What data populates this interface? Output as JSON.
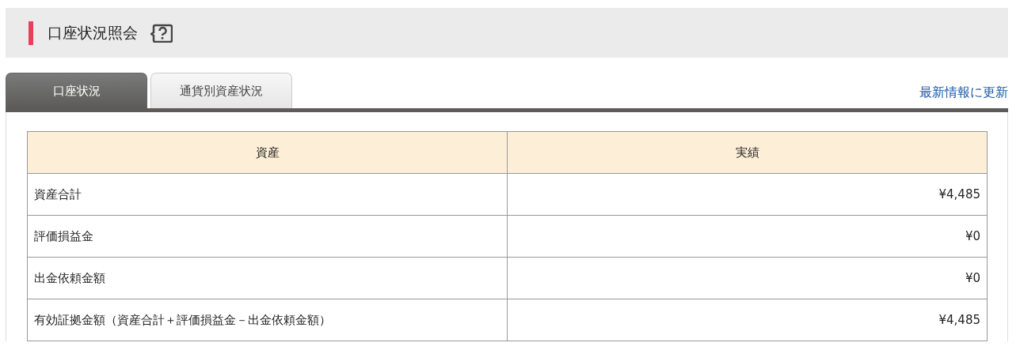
{
  "page_title": "口座状況照会",
  "tabs": [
    {
      "label": "口座状況",
      "selected": true
    },
    {
      "label": "通貨別資産状況",
      "selected": false
    }
  ],
  "refresh_link": "最新情報に更新",
  "table": {
    "columns": [
      "資産",
      "実績"
    ],
    "rows": [
      [
        "資産合計",
        "¥4,485"
      ],
      [
        "評価損益金",
        "¥0"
      ],
      [
        "出金依頼金額",
        "¥0"
      ],
      [
        "有効証拠金額（資産合計＋評価損益金－出金依頼金額）",
        "¥4,485"
      ]
    ]
  }
}
